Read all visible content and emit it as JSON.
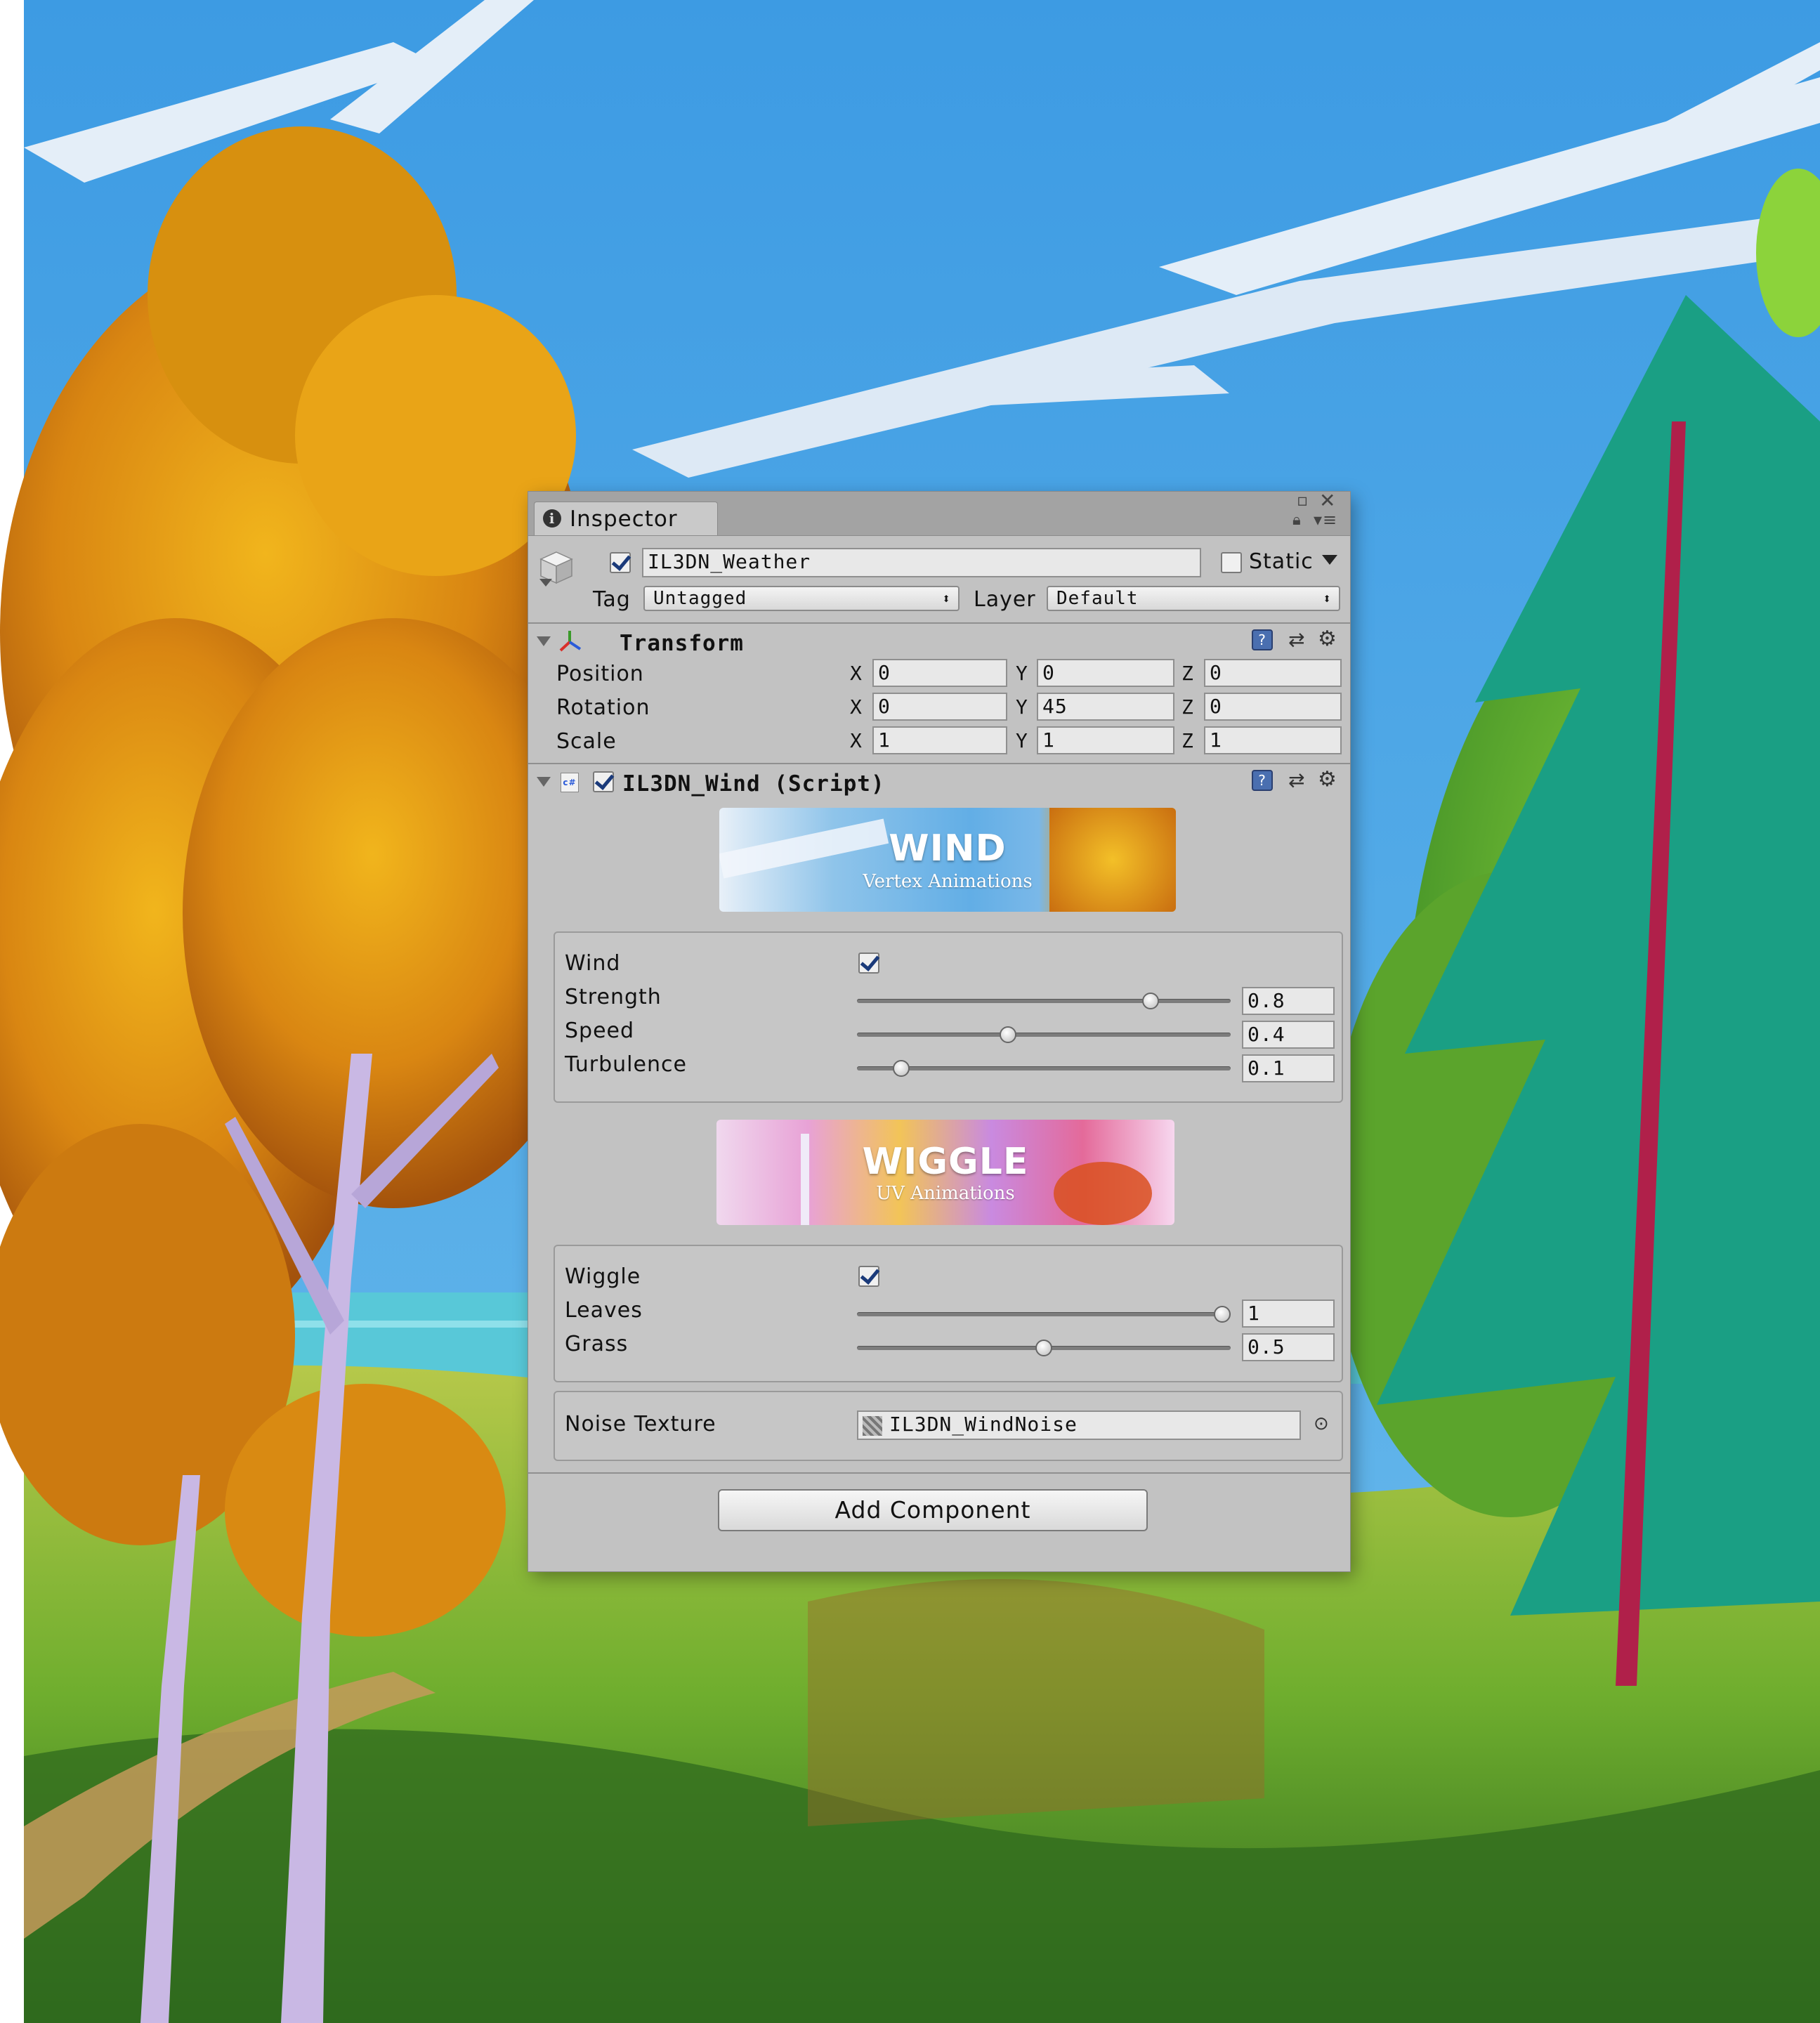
{
  "window": {
    "tab_label": "Inspector",
    "info_icon": "info-icon",
    "controls": [
      "restore-icon",
      "close-icon",
      "lock-icon",
      "context-menu-icon"
    ]
  },
  "gameobject": {
    "active": true,
    "name": "IL3DN_Weather",
    "static_label": "Static",
    "static_checked": false,
    "tag_label": "Tag",
    "tag_value": "Untagged",
    "layer_label": "Layer",
    "layer_value": "Default"
  },
  "transform": {
    "title": "Transform",
    "rows": [
      {
        "label": "Position",
        "x": "0",
        "y": "0",
        "z": "0"
      },
      {
        "label": "Rotation",
        "x": "0",
        "y": "45",
        "z": "0"
      },
      {
        "label": "Scale",
        "x": "1",
        "y": "1",
        "z": "1"
      }
    ],
    "axis": {
      "x": "X",
      "y": "Y",
      "z": "Z"
    }
  },
  "script": {
    "title": "IL3DN_Wind (Script)",
    "enabled": true,
    "icon": "csharp-script-icon",
    "wind_banner": {
      "title": "WIND",
      "subtitle": "Vertex Animations"
    },
    "wiggle_banner": {
      "title": "WIGGLE",
      "subtitle": "UV Animations"
    },
    "wind_group": {
      "toggle_label": "Wind",
      "toggle_checked": true,
      "sliders": [
        {
          "label": "Strength",
          "value": "0.8",
          "fraction": 0.8
        },
        {
          "label": "Speed",
          "value": "0.4",
          "fraction": 0.4
        },
        {
          "label": "Turbulence",
          "value": "0.1",
          "fraction": 0.1
        }
      ]
    },
    "wiggle_group": {
      "toggle_label": "Wiggle",
      "toggle_checked": true,
      "sliders": [
        {
          "label": "Leaves",
          "value": "1",
          "fraction": 1.0
        },
        {
          "label": "Grass",
          "value": "0.5",
          "fraction": 0.5
        }
      ]
    },
    "noise": {
      "label": "Noise Texture",
      "value": "IL3DN_WindNoise"
    }
  },
  "add_component_label": "Add Component",
  "colors": {
    "sky": "#4fa8e6",
    "panel": "#c2c2c2",
    "titlebar": "#a3a3a3"
  }
}
